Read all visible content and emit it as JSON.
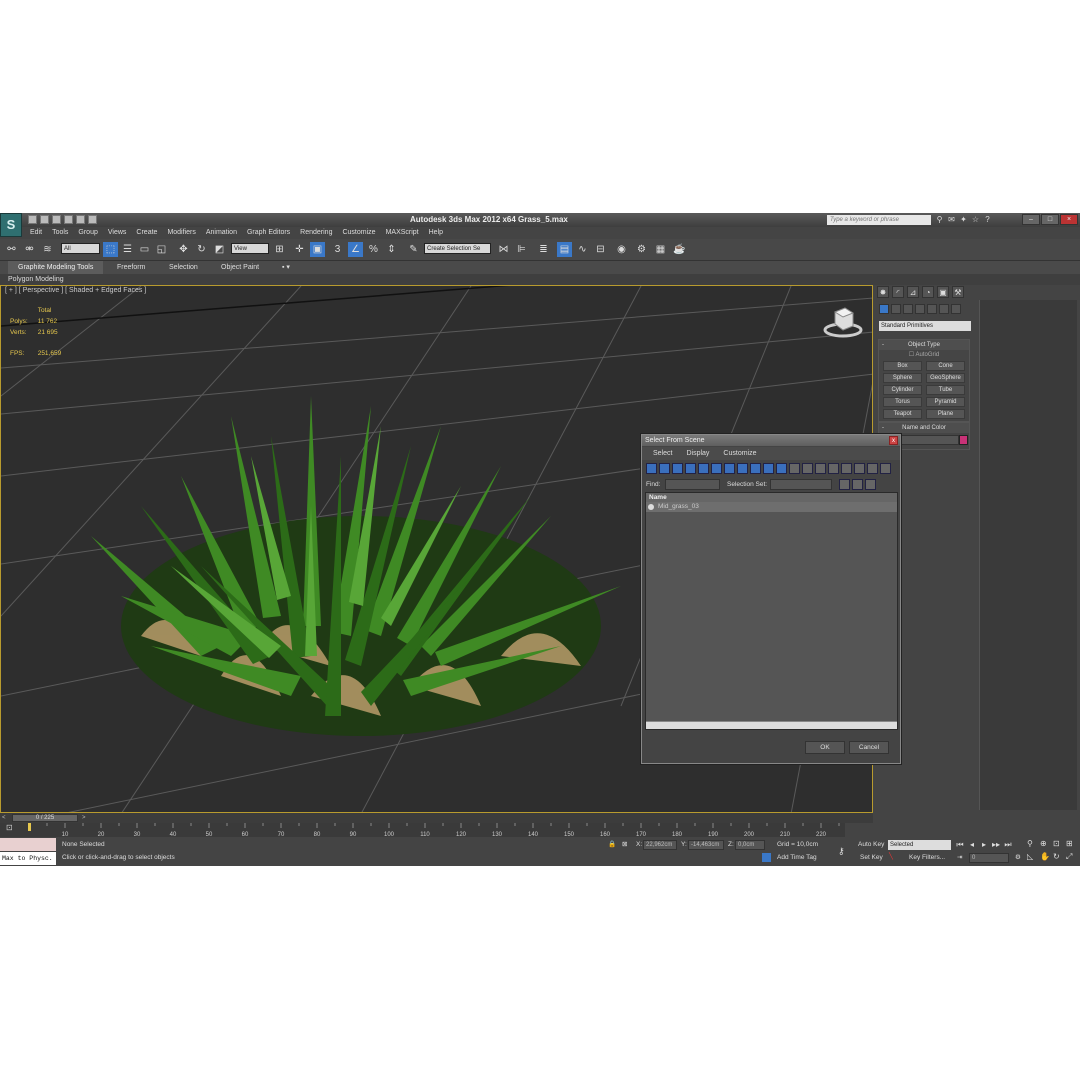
{
  "app": {
    "logo_text": "S",
    "title": "Autodesk 3ds Max  2012 x64     Grass_5.max",
    "search_placeholder": "Type a keyword or phrase"
  },
  "menu": [
    "Edit",
    "Tools",
    "Group",
    "Views",
    "Create",
    "Modifiers",
    "Animation",
    "Graph Editors",
    "Rendering",
    "Customize",
    "MAXScript",
    "Help"
  ],
  "toolbar": {
    "filter": "All",
    "ref_coord": "View",
    "selection_set": "Create Selection Se"
  },
  "ribbon": {
    "tabs": [
      "Graphite Modeling Tools",
      "Freeform",
      "Selection",
      "Object Paint"
    ],
    "panel": "Polygon Modeling"
  },
  "viewport": {
    "label": "[ + ] [ Perspective ] [ Shaded + Edged Faces ]",
    "stats": {
      "total_label": "Total",
      "polys_label": "Polys:",
      "polys": "11 762",
      "verts_label": "Verts:",
      "verts": "21 695",
      "fps_label": "FPS:",
      "fps": "251,659"
    }
  },
  "command_panel": {
    "category": "Standard Primitives",
    "object_type_title": "Object Type",
    "autogrid": "AutoGrid",
    "primitives": [
      "Box",
      "Cone",
      "Sphere",
      "GeoSphere",
      "Cylinder",
      "Tube",
      "Torus",
      "Pyramid",
      "Teapot",
      "Plane"
    ],
    "name_color_title": "Name and Color",
    "accent_color": "#c83277"
  },
  "dialog": {
    "title": "Select From Scene",
    "close": "x",
    "menu": [
      "Select",
      "Display",
      "Customize"
    ],
    "find_label": "Find:",
    "selection_set_label": "Selection Set:",
    "column_name": "Name",
    "rows": [
      "Mid_grass_03"
    ],
    "ok": "OK",
    "cancel": "Cancel"
  },
  "timeline": {
    "slider": "0 / 225",
    "ticks": [
      "10",
      "20",
      "30",
      "40",
      "50",
      "60",
      "70",
      "80",
      "90",
      "100",
      "110",
      "120",
      "130",
      "140",
      "150",
      "160",
      "170",
      "180",
      "190",
      "200",
      "210",
      "220"
    ]
  },
  "status": {
    "script_listener": "Max to Physc.",
    "selection": "None Selected",
    "prompt": "Click or click-and-drag to select objects",
    "x_label": "X:",
    "x": "22,962cm",
    "y_label": "Y:",
    "y": "-14,463cm",
    "z_label": "Z:",
    "z": "0,0cm",
    "grid": "Grid = 10,0cm",
    "add_time_tag": "Add Time Tag",
    "auto_key": "Auto Key",
    "set_key": "Set Key",
    "key_mode": "Selected",
    "key_filters": "Key Filters...",
    "frame": "0"
  }
}
